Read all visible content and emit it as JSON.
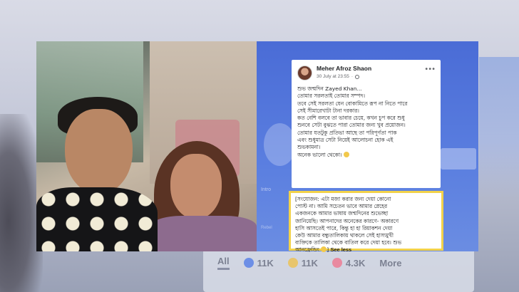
{
  "post": {
    "author": "Meher Afroz Shaon",
    "timestamp": "30 July at 23:55",
    "privacy_icon": "globe-icon",
    "more_icon": "more-options-icon",
    "lines": [
      "শুভ জন্মদিন Zayed Khan...",
      "তোমার সরলতাই তোমার সম্পদ।",
      "তবে সেই সরলতা যেন বোকামিতে রূপ না নিতে পারে",
      "সেই সীমারেখাটা টানা দরকার।",
      "কত বেশি বলবে তা ভাবার চেয়ে, কখন চুপ করে শুধু",
      "শুনবে সেটা বুঝতে পারা তোমার জন্য খুব প্রয়োজন।",
      "তোমার যতটুকু প্রতিভা আছে তা পরিপূর্ণতা পাক",
      "এবং শুধুমাত্র সেটা নিয়েই আলোচনা হোক এই",
      "শুভকামনা।"
    ],
    "closing": "অনেক ভালো থেকো।"
  },
  "addendum": {
    "lines": [
      "[সংযোজন: এটা মজা করার জন্য দেয়া কোনো",
      "পোস্ট না। আমি সচেতন ভাবে আমার স্নেহের",
      "একজনকে আমার ভাষায় জন্মদিনের শুভেচ্ছা",
      "জানিয়েছি। আপনাদের অনেকের কারণে- অকারণে",
      "হাসি আসতেই পারে, কিন্তু হা হা রিয়াকশন দেয়া",
      "কেউ আমার বন্ধুতালিকায় থাকলে সেই হাস্যমুখী",
      "ব্যক্তিকে তালিকা থেকে বাতিল করে দেয়া হবে। শুভ"
    ],
    "last_line": "আনফ্রেন্ডিং",
    "last_line_end": "]",
    "see_less": "See less"
  },
  "reactions": {
    "all_label": "All",
    "items": [
      {
        "icon": "like-icon",
        "count": "11K"
      },
      {
        "icon": "haha-icon",
        "count": "11K"
      },
      {
        "icon": "love-icon",
        "count": "4.3K"
      }
    ],
    "more_label": "More"
  },
  "background_panel": {
    "label_1": "Intro",
    "label_2": "Rebel",
    "accent": "#4a6cd6",
    "highlight": "#f2d24a"
  }
}
